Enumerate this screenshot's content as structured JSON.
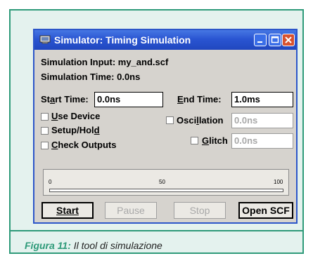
{
  "window": {
    "title": "Simulator: Timing Simulation",
    "icon": "simulator-app-icon",
    "controls": [
      "minimize-icon",
      "maximize-icon",
      "close-icon"
    ]
  },
  "info": {
    "input_label": "Simulation Input: my_and.scf",
    "time_label": "Simulation Time: 0.0ns"
  },
  "times": {
    "start_label": "Start Time:",
    "start_value": "0.0ns",
    "end_label": "End Time:",
    "end_value": "1.0ms"
  },
  "options": {
    "use_device": "Use Device",
    "setup_hold": "Setup/Hold",
    "check_outputs": "Check Outputs",
    "oscillation": "Oscillation",
    "oscillation_value": "0.0ns",
    "glitch": "Glitch",
    "glitch_value": "0.0ns"
  },
  "progress": {
    "tick_labels": [
      "0",
      "50",
      "100"
    ],
    "percent": 0
  },
  "buttons": {
    "start": "Start",
    "pause": "Pause",
    "stop": "Stop",
    "open_scf": "Open SCF"
  },
  "caption": {
    "figure": "Figura 11:",
    "text": " Il tool di simulazione"
  },
  "colors": {
    "frame_accent": "#2e9a79",
    "titlebar": "#2a55d2",
    "dialog_face": "#d6d3ce"
  }
}
